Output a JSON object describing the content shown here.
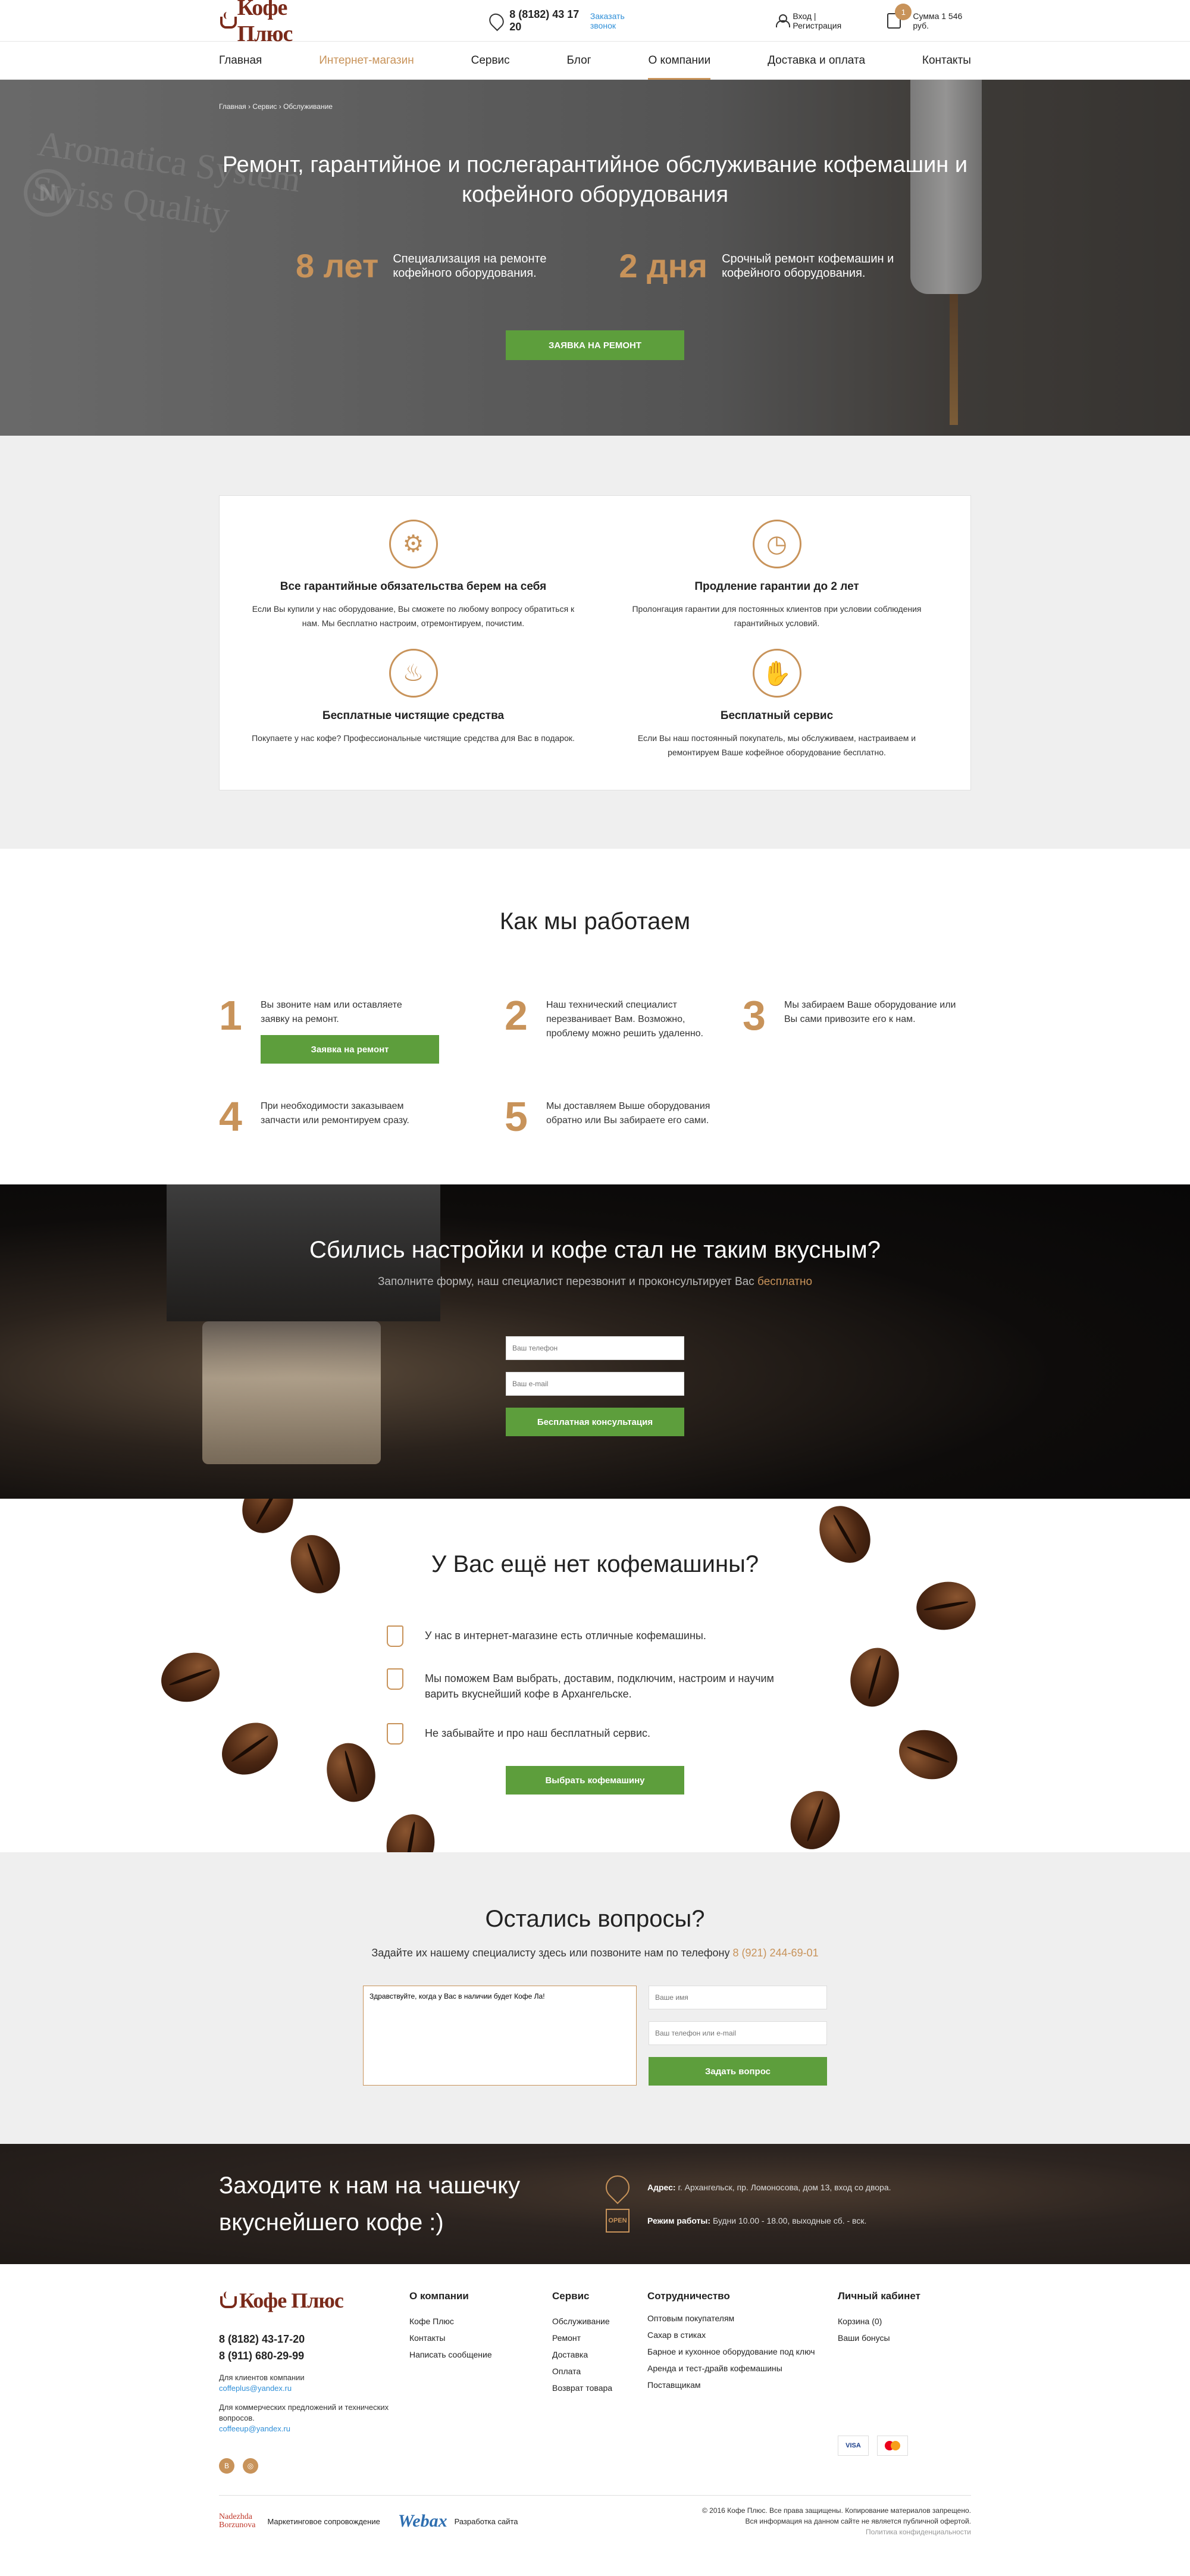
{
  "header": {
    "logo": "Кофе Плюс",
    "phone": "8 (8182) 43 17 20",
    "callback": "Заказать звонок",
    "login": "Вход | Регистрация",
    "cart_count": "1",
    "cart_sum": "Сумма 1 546 руб."
  },
  "nav": [
    "Главная",
    "Интернет-магазин",
    "Сервис",
    "Блог",
    "О компании",
    "Доставка и оплата",
    "Контакты"
  ],
  "hero": {
    "breadcrumb": "Главная › Сервис › Обслуживание",
    "deco_n": "N",
    "deco_line1": "Aromatica System",
    "deco_line2": "Swiss Quality",
    "title": "Ремонт, гарантийное и послегарантийное обслуживание кофемашин и кофейного оборудования",
    "stat1_big": "8 лет",
    "stat1_text": "Специализация на ремонте кофейного оборудования.",
    "stat2_big": "2 дня",
    "stat2_text": "Срочный ремонт кофемашин и кофейного оборудования.",
    "button": "Заявка на ремонт"
  },
  "benefits": [
    {
      "icon": "shield-gear-icon",
      "title": "Все гарантийные обязательства берем на себя",
      "text": "Если Вы купили у нас оборудование, Вы сможете по любому вопросу обратиться к нам. Мы бесплатно настроим, отремонтируем, почистим."
    },
    {
      "icon": "clock-check-icon",
      "title": "Продление гарантии до 2 лет",
      "text": "Пролонгация гарантии для постоянных клиентов при условии соблюдения гарантийных условий."
    },
    {
      "icon": "cleaning-bottle-icon",
      "title": "Бесплатные чистящие средства",
      "text": "Покупаете у нас кофе? Профессиональные чистящие средства для Вас в подарок."
    },
    {
      "icon": "handshake-icon",
      "title": "Бесплатный сервис",
      "text": "Если Вы наш постоянный покупатель, мы обслуживаем, настраиваем и ремонтируем Ваше кофейное оборудование бесплатно."
    }
  ],
  "how": {
    "title": "Как мы работаем",
    "steps": [
      {
        "num": "1",
        "text": "Вы звоните нам или оставляете заявку на ремонт."
      },
      {
        "num": "2",
        "text": "Наш технический специалист перезванивает Вам. Возможно, проблему можно решить удаленно."
      },
      {
        "num": "3",
        "text": "Мы забираем Ваше оборудование или Вы сами привозите его к нам."
      },
      {
        "num": "4",
        "text": "При необходимости заказываем запчасти или ремонтируем сразу."
      },
      {
        "num": "5",
        "text": "Мы доставляем Выше оборудования обратно или Вы забираете его сами."
      }
    ],
    "button": "Заявка на ремонт"
  },
  "consult": {
    "title": "Сбились настройки и кофе стал не таким вкусным?",
    "subtitle": "Заполните форму, наш специалист перезвонит и проконсультирует Вас",
    "subtitle_hl": "бесплатно",
    "phone_ph": "Ваш телефон",
    "email_ph": "Ваш e-mail",
    "button": "Бесплатная консультация"
  },
  "nomachine": {
    "title": "У Вас ещё нет кофемашины?",
    "items": [
      "У нас в интернет-магазине есть отличные кофемашины.",
      "Мы поможем Вам выбрать, доставим, подключим, настроим и научим варить вкуснейший кофе в Архангельске.",
      "Не забывайте и про наш бесплатный сервис."
    ],
    "button": "Выбрать кофемашину"
  },
  "questions": {
    "title": "Остались вопросы?",
    "subtitle": "Задайте их нашему специалисту здесь или позвоните нам по телефону",
    "phone": "8 (921) 244-69-01",
    "message": "Здравствуйте, когда у Вас в наличии будет Кофе Ла!",
    "name_ph": "Ваше имя",
    "contact_ph": "Ваш телефон или e-mail",
    "button": "Задать вопрос"
  },
  "visit": {
    "title": "Заходите к нам на чашечку вкуснейшего кофе :)",
    "address_label": "Адрес:",
    "address": "г. Архангельск, пр. Ломоносова, дом 13, вход со двора.",
    "open_icon_text": "OPEN",
    "hours_label": "Режим работы:",
    "hours": "Будни 10.00 - 18.00, выходные сб. - вск."
  },
  "footer": {
    "logo": "Кофе Плюс",
    "phone1": "8 (8182) 43-17-20",
    "phone2": "8 (911) 680-29-99",
    "note1": "Для клиентов компании",
    "email1": "coffeplus@yandex.ru",
    "note2": "Для коммерческих предложений и технических вопросов.",
    "email2": "coffeeup@yandex.ru",
    "social": [
      "В",
      "◎"
    ],
    "col_company": {
      "title": "О компании",
      "links": [
        "Кофе Плюс",
        "Контакты",
        "Написать сообщение"
      ]
    },
    "col_service": {
      "title": "Сервис",
      "links": [
        "Обслуживание",
        "Ремонт",
        "Доставка",
        "Оплата",
        "Возврат товара"
      ]
    },
    "col_coop": {
      "title": "Сотрудничество",
      "links": [
        "Оптовым покупателям",
        "Сахар в стиках",
        "Барное и кухонное оборудование под ключ",
        "Аренда и тест-драйв кофемашины",
        "Поставщикам"
      ]
    },
    "col_account": {
      "title": "Личный кабинет",
      "links": [
        "Корзина (0)",
        "Ваши бонусы"
      ]
    },
    "visa": "VISA",
    "nb_line1": "Nadezhda",
    "nb_line2": "Borzunova",
    "marketing": "Маркетинговое сопровождение",
    "webax": "Webax",
    "dev": "Разработка сайта",
    "copyright": "© 2016 Кофе Плюс. Все права защищены. Копирование материалов запрещено.",
    "offer": "Вся информация на данном сайте не является публичной офертой.",
    "policy": "Политика конфиденциальности"
  },
  "colors": {
    "accent": "#c8935a",
    "green": "#5d9e3c",
    "link": "#2f8fd8"
  }
}
